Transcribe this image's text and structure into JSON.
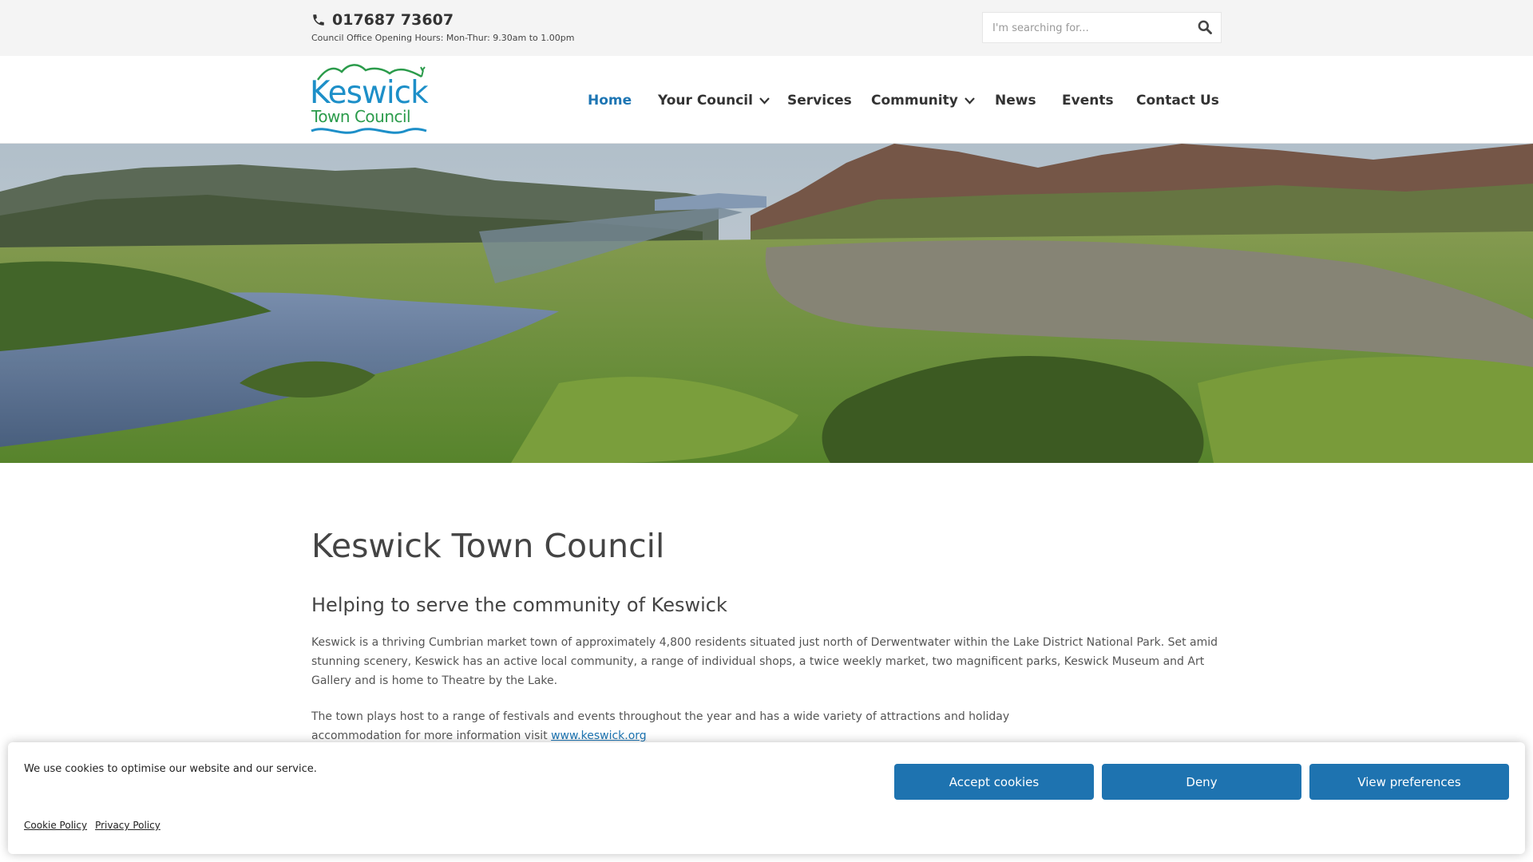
{
  "topbar": {
    "phone": "017687 73607",
    "hours": "Council Office Opening Hours: Mon-Thur: 9.30am to 1.00pm",
    "search_placeholder": "I'm searching for..."
  },
  "logo": {
    "line1": "Keswick",
    "line2": "Town Council"
  },
  "nav": {
    "items": [
      {
        "label": "Home",
        "active": true
      },
      {
        "label": "Your Council",
        "dropdown": true
      },
      {
        "label": "Services"
      },
      {
        "label": "Community",
        "dropdown": true
      },
      {
        "label": "News"
      },
      {
        "label": "Events"
      },
      {
        "label": "Contact Us"
      }
    ]
  },
  "main": {
    "title": "Keswick Town Council",
    "subtitle": "Helping to serve the community of Keswick",
    "para1": "Keswick is a thriving Cumbrian market town of approximately 4,800 residents situated just north of Derwentwater within the Lake District National Park. Set amid stunning scenery, Keswick has an active local community, a range of individual shops, a twice weekly market, two magnificent parks, Keswick Museum and Art Gallery and is home to Theatre by the Lake.",
    "para2_text": "The town plays host to a range of festivals and events throughout the year and has a wide variety of attractions and holiday accommodation for more information visit",
    "para2_link": "www.keswick.org"
  },
  "cookie": {
    "message": "We use cookies to optimise our website and our service.",
    "accept": "Accept cookies",
    "deny": "Deny",
    "preferences": "View preferences",
    "cookie_policy": "Cookie Policy",
    "privacy_policy": "Privacy Policy"
  },
  "colors": {
    "accent": "#1d75b3",
    "button": "#1e73b0",
    "logo_blue": "#1d8fc8",
    "logo_green": "#2b9b4b"
  }
}
